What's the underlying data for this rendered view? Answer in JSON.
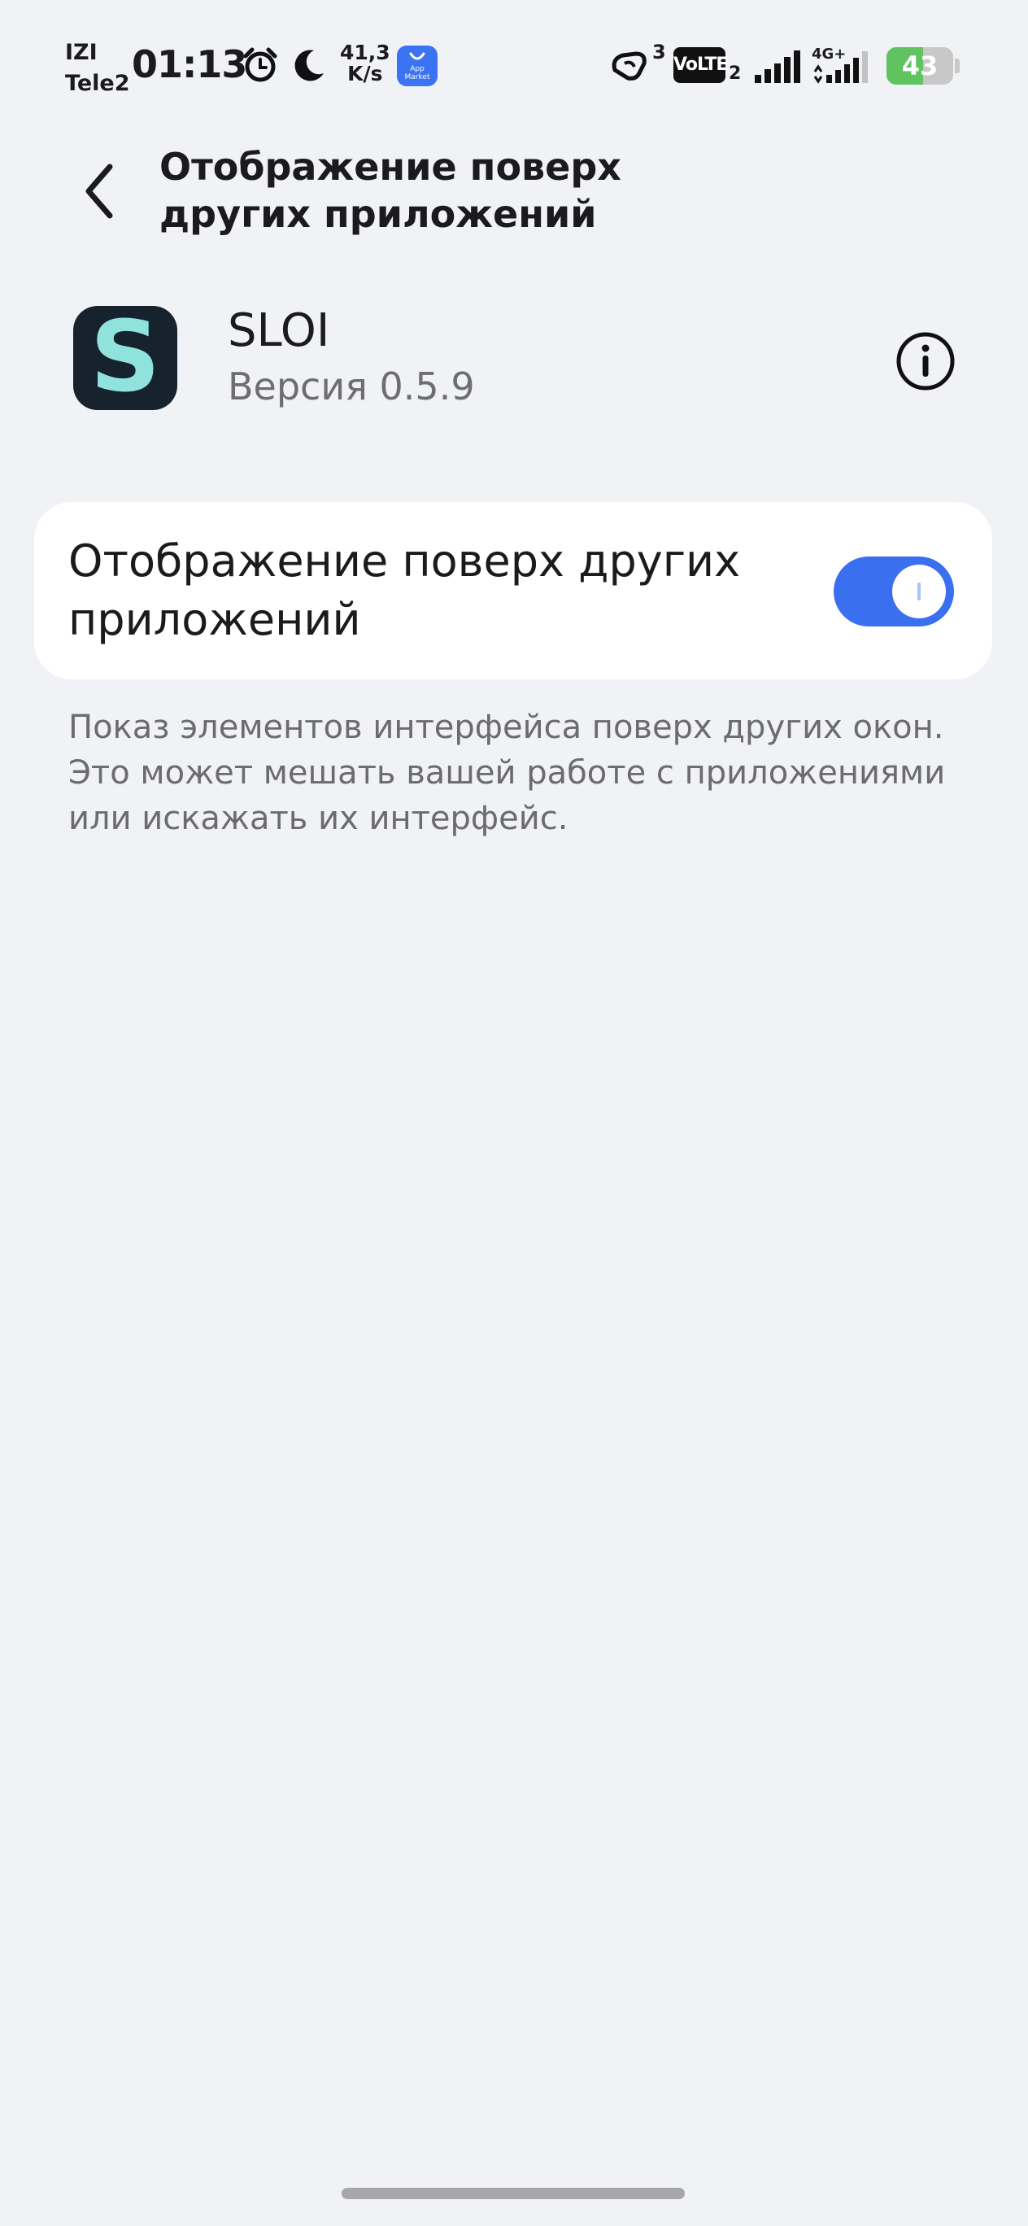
{
  "status_bar": {
    "carrier1": "IZI",
    "carrier2": "Tele2",
    "time": "01:13",
    "speed_value": "41,3",
    "speed_unit": "K/s",
    "app_market_label": "App Market",
    "hd_sup": "3",
    "volte": "VoLTE",
    "volte_sub": "2",
    "network": "4G+",
    "battery": "43",
    "battery_level": 0.55,
    "icons": [
      "alarm-icon",
      "moon-icon",
      "app-market-icon",
      "hd-call-icon",
      "signal-icon",
      "signal-4g-icon",
      "battery-charging-icon"
    ]
  },
  "header": {
    "title": "Отображение поверх других приложений",
    "back_icon": "chevron-left-icon"
  },
  "app": {
    "name": "SLOI",
    "version": "Версия 0.5.9",
    "icon_letter": "S",
    "info_icon": "info-icon"
  },
  "setting": {
    "label": "Отображение поверх других приложений",
    "enabled": true,
    "description": "Показ элементов интерфейса поверх других окон. Это может мешать вашей работе с приложениями или искажать их интерфейс."
  },
  "colors": {
    "background": "#f0f2f6",
    "accent": "#3a6ff0",
    "battery_green": "#5fc45f"
  }
}
